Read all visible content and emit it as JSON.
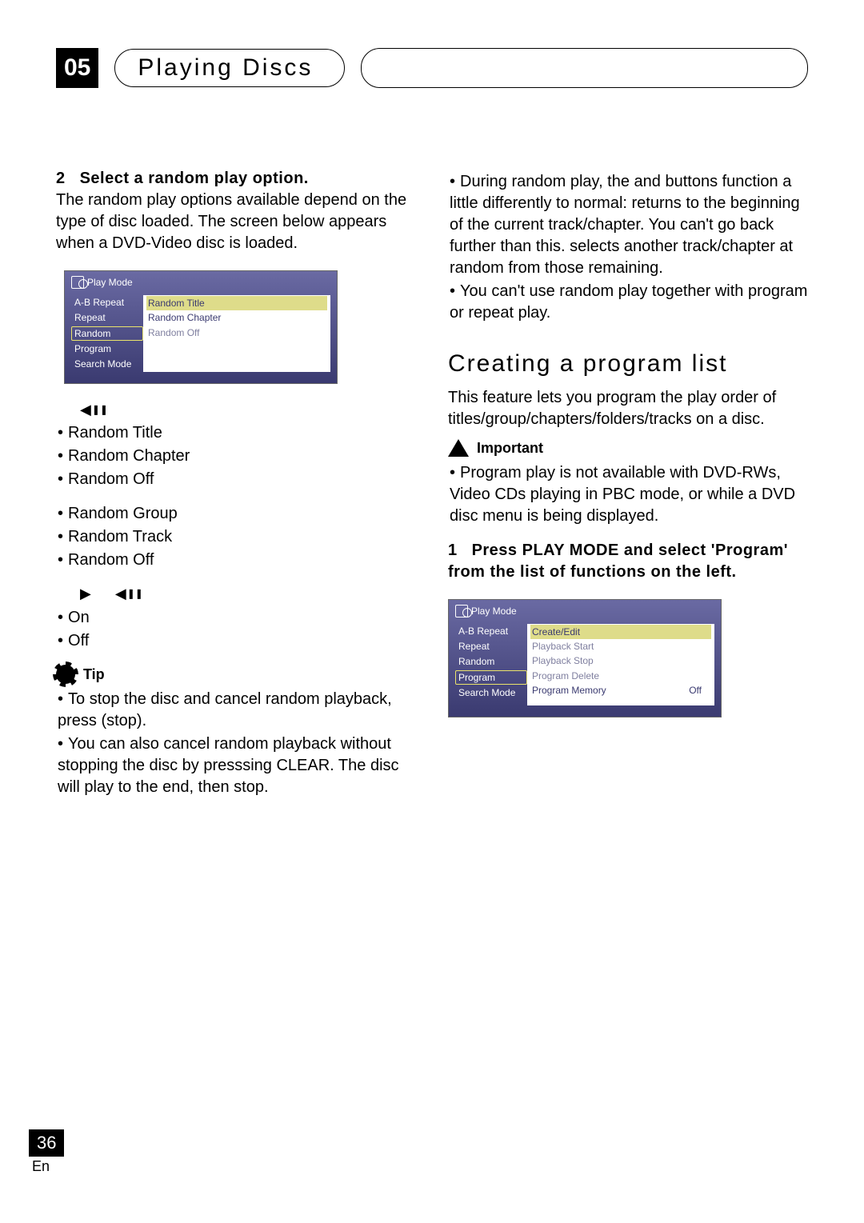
{
  "header": {
    "chapter_num": "05",
    "chapter_title": "Playing Discs"
  },
  "left": {
    "step_num": "2",
    "step_title": "Select a random play option.",
    "step_body": "The random play options available depend on the type of disc loaded. The screen below appears when a DVD-Video disc is loaded.",
    "osd1": {
      "title": "Play Mode",
      "left_items": [
        "A-B Repeat",
        "Repeat",
        "Random",
        "Program",
        "Search Mode"
      ],
      "left_selected_index": 2,
      "right_items": [
        "Random Title",
        "Random Chapter",
        "Random Off"
      ],
      "right_hl_index": 0,
      "right_dim_index": 2
    },
    "list1": [
      "Random Title",
      "Random Chapter",
      "Random Off"
    ],
    "list2": [
      "Random Group",
      "Random Track",
      "Random Off"
    ],
    "list3": [
      "On",
      "Off"
    ],
    "tip_label": "Tip",
    "tips": [
      "To stop the disc and cancel random playback, press      (stop).",
      "You can also cancel random playback without stopping the disc by presssing CLEAR. The disc will play to the end, then stop."
    ]
  },
  "right": {
    "notes": [
      "During random play, the      and      buttons function a little differently to normal:      returns to the beginning of the current track/chapter. You can't go back further than this.      selects another track/chapter at random from those remaining.",
      "You can't use random play together with program or repeat play."
    ],
    "h2": "Creating a program list",
    "intro": "This feature lets you program the play order of titles/group/chapters/folders/tracks on a disc.",
    "important_label": "Important",
    "important_items": [
      "Program play is not available with DVD-RWs, Video CDs playing in PBC mode, or while a DVD disc menu is being displayed."
    ],
    "step_num": "1",
    "step_title": "Press PLAY MODE and select 'Program' from the list of functions on the left.",
    "osd2": {
      "title": "Play Mode",
      "left_items": [
        "A-B Repeat",
        "Repeat",
        "Random",
        "Program",
        "Search Mode"
      ],
      "left_selected_index": 3,
      "right_items": [
        "Create/Edit",
        "Playback Start",
        "Playback Stop",
        "Program Delete",
        "Program Memory"
      ],
      "right_hl_index": 0,
      "right_dim": [
        1,
        2,
        3
      ],
      "right_value_row": 4,
      "right_value": "Off"
    }
  },
  "footer": {
    "page": "36",
    "lang": "En"
  }
}
